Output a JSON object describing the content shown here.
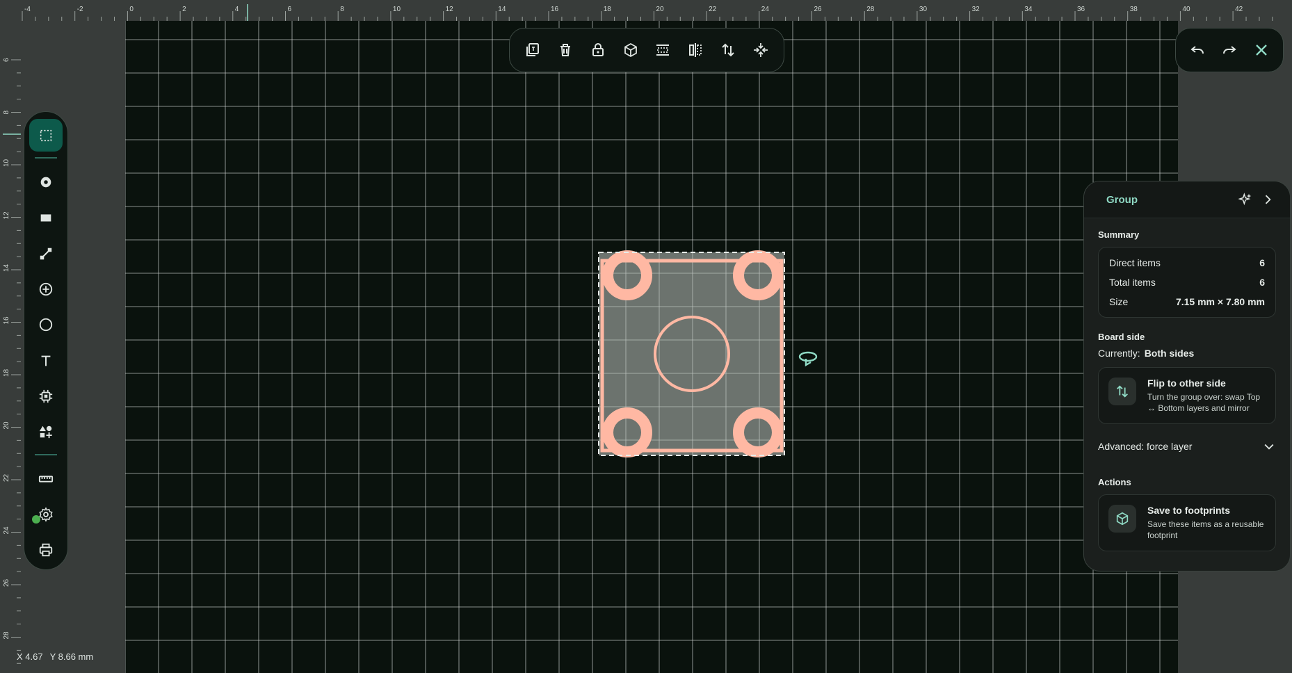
{
  "colors": {
    "accent": "#8fd9c4",
    "copper": "#ffb8a3",
    "canvas_bg": "#0a120d",
    "grid": "#d0d4d2",
    "selection_fill": "#6c736e"
  },
  "ruler": {
    "top_labels": [
      "-4",
      "-2",
      "0",
      "2",
      "4",
      "6",
      "8",
      "10",
      "12",
      "14",
      "16",
      "18",
      "20",
      "22",
      "24",
      "26",
      "28",
      "30",
      "32",
      "34",
      "36",
      "38",
      "40",
      "42"
    ],
    "left_labels": [
      "6",
      "8",
      "10",
      "12",
      "14",
      "16",
      "18",
      "20",
      "22",
      "24",
      "26",
      "28"
    ]
  },
  "top_toolbar": [
    {
      "icon": "copy-icon",
      "label": "Duplicate"
    },
    {
      "icon": "trash-icon",
      "label": "Delete"
    },
    {
      "icon": "lock-icon",
      "label": "Lock"
    },
    {
      "icon": "cube-icon",
      "label": "3D view"
    },
    {
      "icon": "align-icon",
      "label": "Align"
    },
    {
      "icon": "mirror-icon",
      "label": "Mirror"
    },
    {
      "icon": "flip-icon",
      "label": "Flip"
    },
    {
      "icon": "ungroup-icon",
      "label": "Ungroup"
    }
  ],
  "history_toolbar": [
    {
      "icon": "undo-icon",
      "label": "Undo"
    },
    {
      "icon": "redo-icon",
      "label": "Redo"
    },
    {
      "icon": "close-icon",
      "label": "Close"
    }
  ],
  "tools": [
    {
      "icon": "select-icon",
      "label": "Select",
      "active": true
    },
    {
      "icon": "via-icon",
      "label": "Via"
    },
    {
      "icon": "rect-pad-icon",
      "label": "Pad"
    },
    {
      "icon": "trace-icon",
      "label": "Trace"
    },
    {
      "icon": "add-circle-icon",
      "label": "Add"
    },
    {
      "icon": "circle-icon",
      "label": "Circle"
    },
    {
      "icon": "text-icon",
      "label": "Text"
    },
    {
      "icon": "chip-icon",
      "label": "Component"
    },
    {
      "icon": "shapes-add-icon",
      "label": "Shapes"
    },
    {
      "icon": "ruler-icon",
      "label": "Measure"
    },
    {
      "icon": "gear-icon",
      "label": "Settings"
    },
    {
      "icon": "print-icon",
      "label": "Print"
    }
  ],
  "status": {
    "x_label": "X 4.67",
    "y_label": "Y 8.66 mm"
  },
  "panel": {
    "title": "Group",
    "summary_title": "Summary",
    "summary": [
      {
        "key": "Direct items",
        "value": "6"
      },
      {
        "key": "Total items",
        "value": "6"
      },
      {
        "key": "Size",
        "value": "7.15 mm × 7.80 mm"
      }
    ],
    "board_side_title": "Board side",
    "currently_label": "Currently:",
    "currently_value": "Both sides",
    "flip": {
      "title": "Flip to other side",
      "desc": "Turn the group over: swap Top ↔ Bottom layers and mirror"
    },
    "advanced_label": "Advanced: force layer",
    "actions_title": "Actions",
    "save": {
      "title": "Save to footprints",
      "desc": "Save these items as a reusable footprint"
    }
  }
}
